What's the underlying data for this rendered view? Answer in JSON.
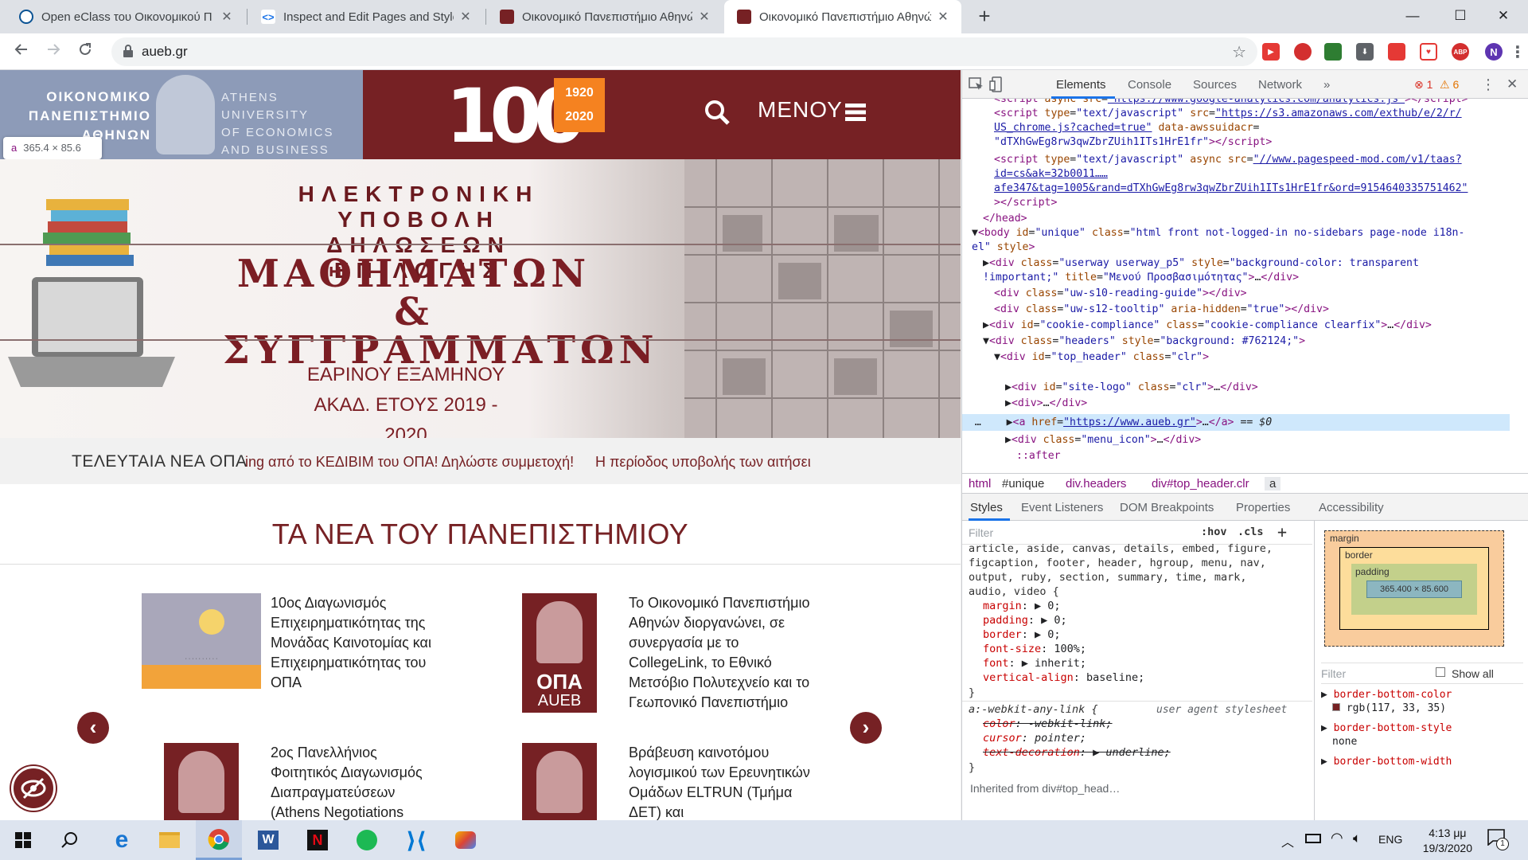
{
  "browser": {
    "tabs": [
      {
        "title": "Open eClass του Οικονομικού Π",
        "favicon_color": "#0b5394",
        "active": false
      },
      {
        "title": "Inspect and Edit Pages and Styles",
        "favicon_color": "#1a73e8",
        "active": false
      },
      {
        "title": "Οικονομικό Πανεπιστήμιο Αθηνώ",
        "favicon_color": "#762124",
        "active": false
      },
      {
        "title": "Οικονομικό Πανεπιστήμιο Αθηνώ",
        "favicon_color": "#762124",
        "active": true
      }
    ],
    "url": "aueb.gr",
    "profile_initial": "N",
    "window_controls": {
      "minimize": "—",
      "maximize": "☐",
      "close": "✕"
    }
  },
  "page": {
    "logo_gr": [
      "ΟΙΚΟΝΟΜΙΚΟ",
      "ΠΑΝΕΠΙΣΤΗΜΙΟ",
      "ΑΘΗΝΩΝ"
    ],
    "logo_en": [
      "ATHENS UNIVERSITY",
      "OF ECONOMICS",
      "AND BUSINESS"
    ],
    "centenary": "100",
    "centenary_years": [
      "1920",
      "2020"
    ],
    "menu_label": "ΜΕΝΟΥ",
    "element_tooltip": {
      "tag": "a",
      "size": "365.4 × 85.6"
    },
    "banner": {
      "line1": "ΗΛΕΚΤΡΟΝΙΚΗ ΥΠΟΒΟΛΗ",
      "line2": "ΔΗΛΩΣΕΩΝ ΕΠΙΛΟΓΗΣ",
      "line3": "ΜΑΘΗΜΑΤΩΝ &",
      "line4": "ΣΥΓΓΡΑΜΜΑΤΩΝ",
      "line5": "ΕΑΡΙΝΟΥ ΕΞΑΜΗΝΟΥ",
      "line6": "ΑΚΑΔ. ΕΤΟΥΣ 2019 - 2020"
    },
    "ticker": {
      "label": "ΤΕΛΕΥΤΑΙΑ ΝΕΑ ΟΠΑ",
      "item1": "ing από το ΚΕΔΙΒΙΜ του ΟΠΑ! Δηλώστε συμμετοχή!",
      "item2": "Η περίοδος υποβολής των αιτήσει"
    },
    "news_title": "ΤΑ ΝΕΑ ΤΟΥ ΠΑΝΕΠΙΣΤΗΜΙΟΥ",
    "news": [
      {
        "text": "10ος Διαγωνισμός Επιχειρηματικότητας της Μονάδας Καινοτομίας και Επιχειρηματικότητας του ΟΠΑ"
      },
      {
        "text": "Το Οικονομικό Πανεπιστήμιο Αθηνών διοργανώνει, σε συνεργασία με το CollegeLink, το Εθνικό Μετσόβιο Πολυτεχνείο και το Γεωπονικό Πανεπιστήμιο",
        "badge_line1": "ΟΠΑ",
        "badge_line2": "AUEB"
      },
      {
        "text": "2ος Πανελλήνιος Φοιτητικός Διαγωνισμός Διαπραγματεύσεων (Athens Negotiations Tournament)"
      },
      {
        "text": "Βράβευση καινοτόμου λογισμικού των Ερευνητικών Ομάδων ELTRUN (Τμήμα ΔΕΤ) και"
      }
    ],
    "arrow_prev": "‹",
    "arrow_next": "›"
  },
  "devtools": {
    "tabs": [
      "Elements",
      "Console",
      "Sources",
      "Network",
      "»"
    ],
    "errors": "1",
    "warnings": "6",
    "breadcrumbs": [
      "html",
      "#unique",
      "div.headers",
      "div#top_header.clr",
      "a"
    ],
    "styles_tabs": [
      "Styles",
      "Event Listeners",
      "DOM Breakpoints",
      "Properties",
      "Accessibility"
    ],
    "filter_placeholder": "Filter",
    "hov": ":hov",
    "cls": ".cls",
    "plus": "+",
    "ua_label": "user agent stylesheet",
    "inherited_label": "Inherited from div#top_head…",
    "box_model": {
      "margin": "margin",
      "border": "border",
      "padding": "padding",
      "content": "365.400 × 85.600",
      "dash": "–"
    },
    "computed_filter": "Filter",
    "show_all": "Show all",
    "computed": [
      {
        "prop": "border-bottom-color",
        "val": "rgb(117, 33, 35)"
      },
      {
        "prop": "border-bottom-style",
        "val": "none"
      },
      {
        "prop": "border-bottom-width",
        "val": ""
      }
    ]
  },
  "taskbar": {
    "time": "4:13 μμ",
    "date": "19/3/2020",
    "lang": "ENG",
    "notifications": "1"
  }
}
